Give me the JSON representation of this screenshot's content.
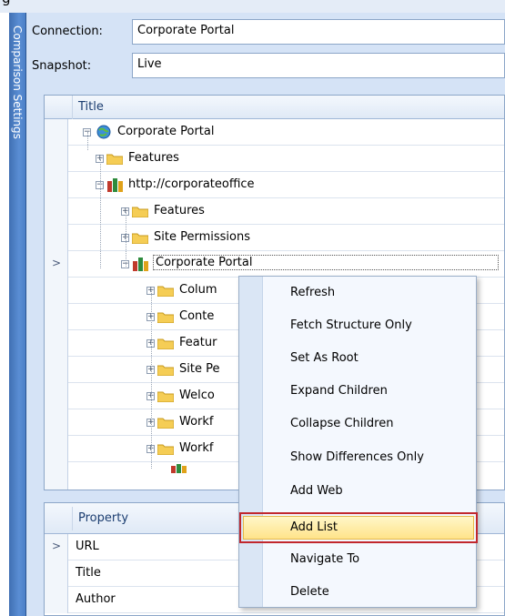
{
  "top_strip_text": "g",
  "sidebar": {
    "title": "Comparison Settings"
  },
  "connection": {
    "label": "Connection:",
    "value": "Corporate Portal"
  },
  "snapshot": {
    "label": "Snapshot:",
    "value": "Live"
  },
  "tree_grid": {
    "header": "Title",
    "rows": [
      {
        "label": "Corporate Portal",
        "icon": "globe-icon"
      },
      {
        "label": "Features",
        "icon": "folder-icon"
      },
      {
        "label": "http://corporateoffice",
        "icon": "site-group-icon"
      },
      {
        "label": "Features",
        "icon": "folder-icon"
      },
      {
        "label": "Site Permissions",
        "icon": "folder-icon"
      },
      {
        "label": "Corporate Portal",
        "icon": "site-icon"
      },
      {
        "label": "Colum",
        "icon": "folder-icon"
      },
      {
        "label": "Conte",
        "icon": "folder-icon"
      },
      {
        "label": "Featur",
        "icon": "folder-icon"
      },
      {
        "label": "Site Pe",
        "icon": "folder-icon"
      },
      {
        "label": "Welco",
        "icon": "folder-icon"
      },
      {
        "label": "Workf",
        "icon": "folder-icon"
      },
      {
        "label": "Workf",
        "icon": "folder-icon"
      }
    ]
  },
  "property_grid": {
    "header": "Property",
    "rows": [
      "URL",
      "Title",
      "Author"
    ]
  },
  "context_menu": {
    "items": [
      "Refresh",
      "Fetch Structure Only",
      "Set As Root",
      "Expand Children",
      "Collapse Children",
      "Show Differences Only",
      "Add Web",
      "Add List",
      "Navigate To",
      "Delete"
    ],
    "highlighted": "Add List"
  },
  "colors": {
    "panel_bg": "#d5e3f6",
    "sidebar": "#4c80c7",
    "highlight_border": "#c1272d",
    "highlight_fill": "#ffe38a"
  }
}
